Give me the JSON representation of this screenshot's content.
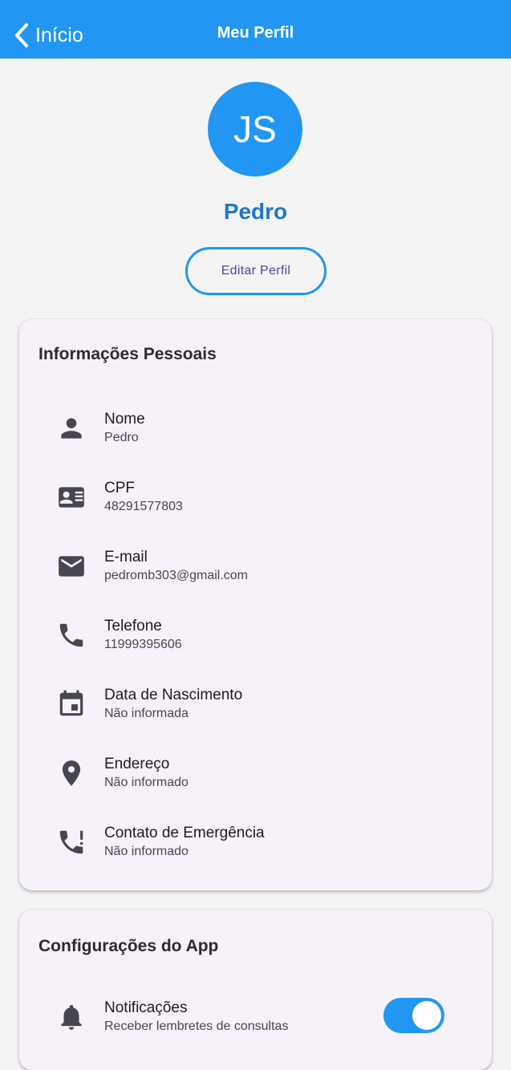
{
  "appbar": {
    "back_label": "Início",
    "title": "Meu Perfil",
    "color": "#2196f3"
  },
  "profile": {
    "initials": "JS",
    "name": "Pedro",
    "edit_button": "Editar Perfil"
  },
  "personal_info": {
    "title": "Informações Pessoais",
    "items": [
      {
        "icon": "person-icon",
        "label": "Nome",
        "value": "Pedro"
      },
      {
        "icon": "id-card-icon",
        "label": "CPF",
        "value": "48291577803"
      },
      {
        "icon": "email-icon",
        "label": "E-mail",
        "value": "pedromb303@gmail.com"
      },
      {
        "icon": "phone-icon",
        "label": "Telefone",
        "value": "11999395606"
      },
      {
        "icon": "calendar-icon",
        "label": "Data de Nascimento",
        "value": "Não informada"
      },
      {
        "icon": "location-pin-icon",
        "label": "Endereço",
        "value": "Não informado"
      },
      {
        "icon": "emergency-phone-icon",
        "label": "Contato de Emergência",
        "value": "Não informado"
      }
    ]
  },
  "app_settings": {
    "title": "Configurações do App",
    "items": [
      {
        "icon": "bell-icon",
        "label": "Notificações",
        "value": "Receber lembretes de consultas",
        "enabled": true
      }
    ]
  }
}
